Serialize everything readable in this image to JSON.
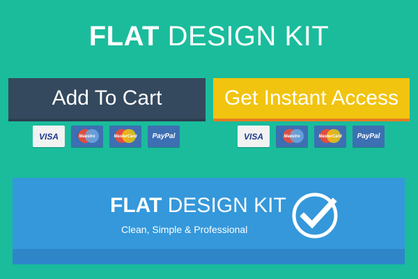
{
  "title": {
    "bold": "FLAT",
    "light": " DESIGN KIT"
  },
  "buttons": {
    "add_to_cart": "Add To Cart",
    "get_instant_access": "Get Instant Access"
  },
  "cards": {
    "visa": "VISA",
    "maestro": "Maestro",
    "mastercard": "MasterCard",
    "paypal": "PayPal"
  },
  "banner": {
    "bold": "FLAT",
    "light": " DESIGN KIT",
    "subtitle": "Clean, Simple & Professional",
    "icon": "checkmark-circle-icon"
  },
  "colors": {
    "background": "#1abc9c",
    "cart_button": "#34495e",
    "access_button": "#f1c40f",
    "access_button_border": "#e67e22",
    "banner": "#3498db"
  }
}
